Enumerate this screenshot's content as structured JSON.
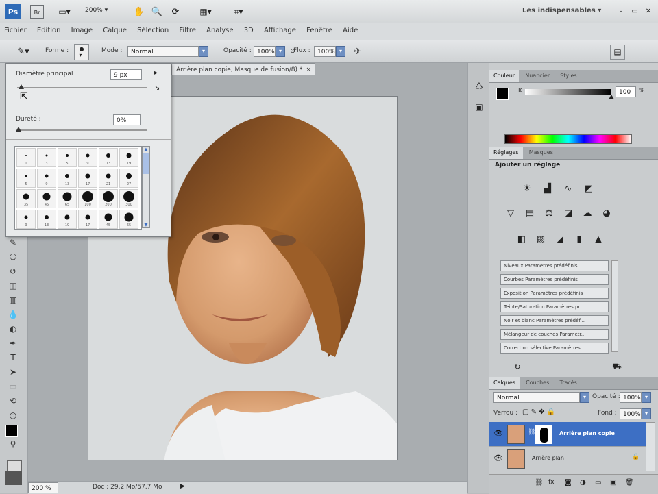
{
  "appbar": {
    "zoom": "200%",
    "workspace": "Les indispensables",
    "icons": [
      "ps-logo-icon",
      "bridge-icon",
      "screen-mode-icon",
      "zoom-level",
      "hand-icon",
      "zoom-icon",
      "rotate-icon",
      "arrange-icon",
      "extras-icon"
    ]
  },
  "menu": {
    "items": [
      "Fichier",
      "Edition",
      "Image",
      "Calque",
      "Sélection",
      "Filtre",
      "Analyse",
      "3D",
      "Affichage",
      "Fenêtre",
      "Aide"
    ]
  },
  "options": {
    "forme_label": "Forme :",
    "mode_label": "Mode :",
    "mode_value": "Normal",
    "opacity_label": "Opacité :",
    "opacity_value": "100%",
    "flux_label": "Flux :",
    "flux_value": "100%"
  },
  "brush_popup": {
    "diameter_label": "Diamètre principal",
    "diameter_value": "9 px",
    "hardness_label": "Dureté :",
    "hardness_value": "0%",
    "brushes": [
      {
        "size": 1,
        "label": "1"
      },
      {
        "size": 3,
        "label": "3"
      },
      {
        "size": 5,
        "label": "5"
      },
      {
        "size": 9,
        "label": "9"
      },
      {
        "size": 13,
        "label": "13"
      },
      {
        "size": 19,
        "label": "19"
      },
      {
        "size": 5,
        "label": "5"
      },
      {
        "size": 9,
        "label": "9"
      },
      {
        "size": 13,
        "label": "13"
      },
      {
        "size": 17,
        "label": "17"
      },
      {
        "size": 21,
        "label": "21"
      },
      {
        "size": 27,
        "label": "27"
      },
      {
        "size": 35,
        "label": "35"
      },
      {
        "size": 45,
        "label": "45"
      },
      {
        "size": 65,
        "label": "65"
      },
      {
        "size": 100,
        "label": "100"
      },
      {
        "size": 200,
        "label": "200"
      },
      {
        "size": 300,
        "label": "300"
      },
      {
        "size": 9,
        "label": "9"
      },
      {
        "size": 13,
        "label": "13"
      },
      {
        "size": 19,
        "label": "19"
      },
      {
        "size": 17,
        "label": "17"
      },
      {
        "size": 45,
        "label": "45"
      },
      {
        "size": 65,
        "label": "65"
      }
    ]
  },
  "document": {
    "tab_title": "Arrière plan copie, Masque de fusion/8) *",
    "tab_close": "×",
    "zoom": "200 %",
    "doc_info": "Doc : 29,2 Mo/57,7 Mo"
  },
  "color_panel": {
    "tabs": [
      "Couleur",
      "Nuancier",
      "Styles"
    ],
    "k_value": "100",
    "k_unit": "%"
  },
  "adjustments_panel": {
    "tabs": [
      "Réglages",
      "Masques"
    ],
    "title": "Ajouter un réglage",
    "row1": [
      "brightness-icon",
      "levels-icon",
      "curves-icon",
      "exposure-icon"
    ],
    "row2": [
      "vibrance-icon",
      "hue-sat-icon",
      "color-balance-icon",
      "bw-icon",
      "photo-filter-icon",
      "channel-mixer-icon"
    ],
    "row3": [
      "invert-icon",
      "posterize-icon",
      "threshold-icon",
      "gradient-map-icon",
      "selective-color-icon"
    ],
    "presets": [
      "Niveaux Paramètres prédéfinis",
      "Courbes Paramètres prédéfinis",
      "Exposition Paramètres prédéfinis",
      "Teinte/Saturation Paramètres pr...",
      "Noir et blanc Paramètres prédéf...",
      "Mélangeur de couches Paramètr...",
      "Correction sélective Paramètres..."
    ]
  },
  "layers_panel": {
    "tabs": [
      "Calques",
      "Couches",
      "Tracés"
    ],
    "blend_mode": "Normal",
    "opacity_label": "Opacité :",
    "opacity_value": "100%",
    "lock_label": "Verrou :",
    "fill_label": "Fond :",
    "fill_value": "100%",
    "layers": [
      {
        "name": "Arrière plan copie",
        "selected": true
      },
      {
        "name": "Arrière plan",
        "selected": false
      }
    ]
  },
  "colors": {
    "accent": "#3d6fc4",
    "selected_layer": "#3d6fc4",
    "panel_bg": "#c9ccce"
  }
}
